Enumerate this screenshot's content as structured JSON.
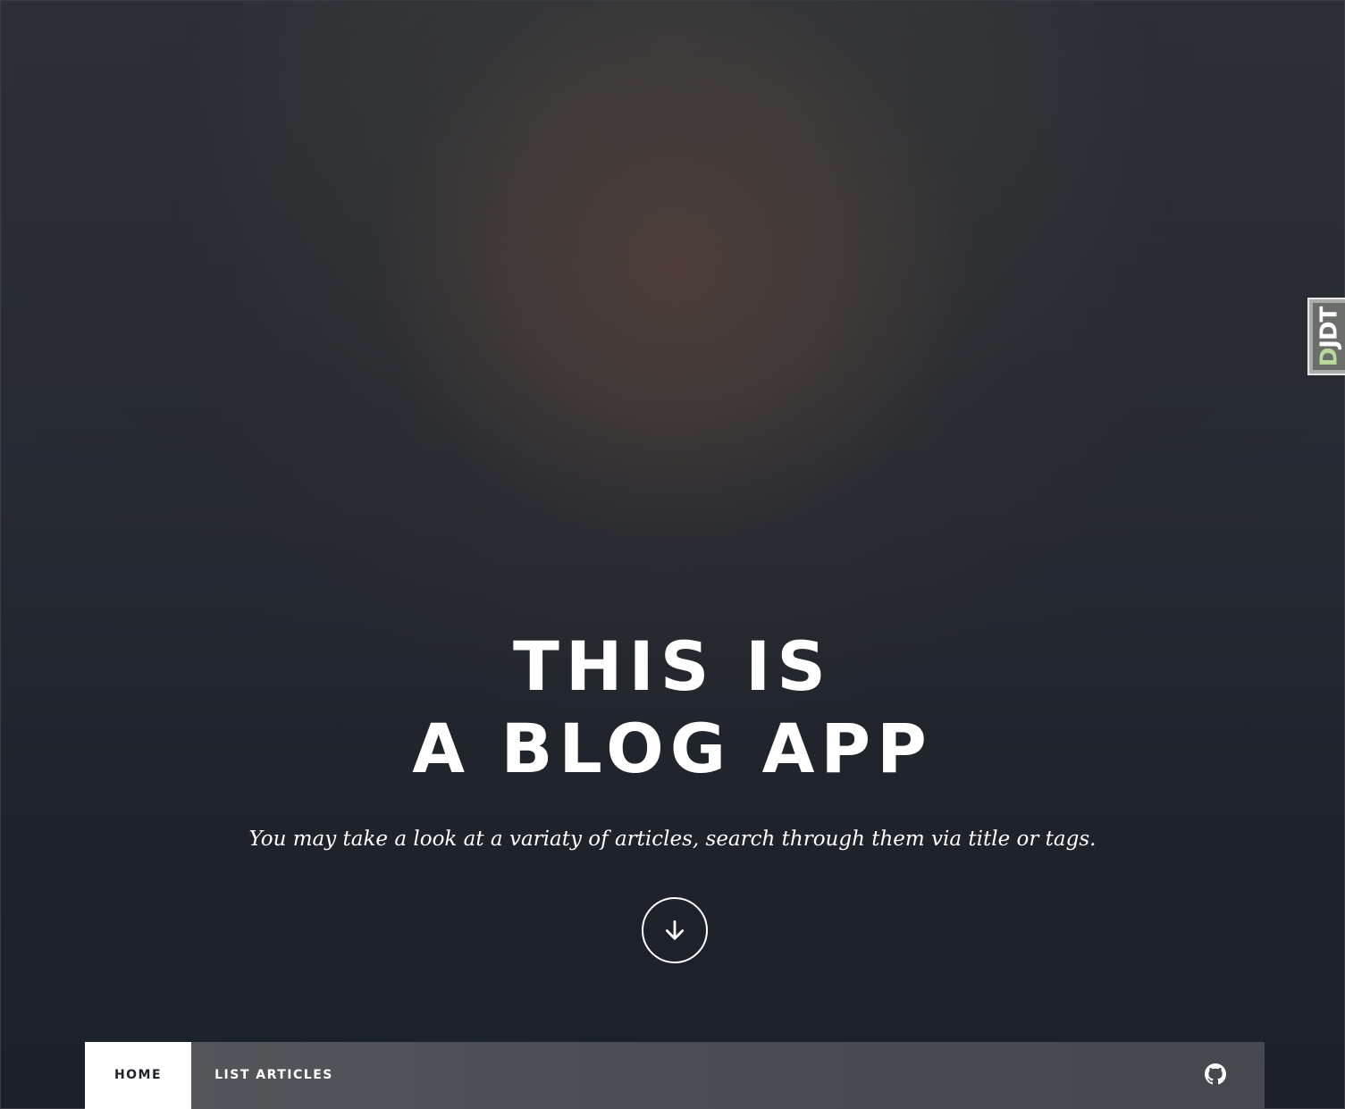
{
  "hero": {
    "title_line1": "THIS IS",
    "title_line2": "A BLOG APP",
    "subtitle": "You may take a look at a variaty of articles, search through them via title or tags.",
    "scroll_icon": "arrow-down-icon"
  },
  "nav": {
    "items": [
      {
        "label": "HOME",
        "active": true
      },
      {
        "label": "LIST ARTICLES",
        "active": false
      }
    ],
    "github_icon": "github-icon"
  },
  "debug_toolbar": {
    "label_first": "D",
    "label_rest": "JDT"
  },
  "colors": {
    "background_dark": "#1d222b",
    "navbar": "#4a4d53",
    "nav_active_bg": "#ffffff",
    "nav_active_text": "#1f2329",
    "text_light": "#ffffff",
    "djdt_accent": "#b9d99a"
  }
}
